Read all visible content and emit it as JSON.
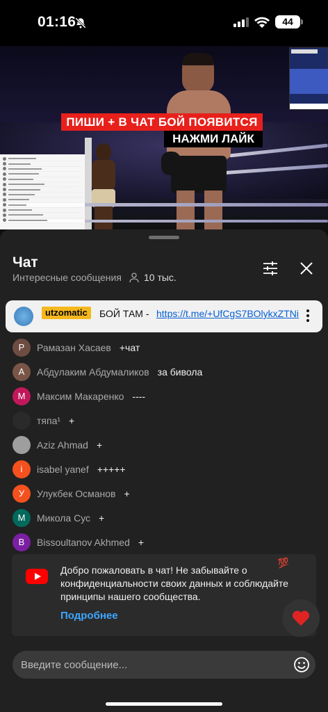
{
  "status_bar": {
    "time": "01:16",
    "battery": "44"
  },
  "video": {
    "promo_line1": "ПИШИ + В ЧАТ БОЙ ПОЯВИТСЯ",
    "promo_line2": "НАЖМИ ЛАЙК"
  },
  "chat": {
    "title": "Чат",
    "subtitle": "Интересные сообщения",
    "viewer_count": "10 тыс.",
    "pinned": {
      "author": "utzomatic",
      "text": "БОЙ ТАМ -",
      "link": "https://t.me/+UfCgS7BOlykxZTNi"
    },
    "messages": [
      {
        "initial": "Р",
        "color": "#6d4c41",
        "author": "Рамазан Хасаев",
        "text": "+чат"
      },
      {
        "initial": "А",
        "color": "#795548",
        "author": "Абдулаким Абдумаликов",
        "text": "за бивола"
      },
      {
        "initial": "М",
        "color": "#c2185b",
        "author": "Максим Макаренко",
        "text": "----"
      },
      {
        "initial": "",
        "color": "#2a2a2a",
        "author": "тяпа¹",
        "text": "+"
      },
      {
        "initial": "",
        "color": "#9e9e9e",
        "author": "Aziz Ahmad",
        "text": "+"
      },
      {
        "initial": "i",
        "color": "#f4511e",
        "author": "isabel yanef",
        "text": "+++++"
      },
      {
        "initial": "У",
        "color": "#f4511e",
        "author": "Улукбек Османов",
        "text": "+"
      },
      {
        "initial": "М",
        "color": "#00695c",
        "author": "Микола Сус",
        "text": "+"
      },
      {
        "initial": "B",
        "color": "#7b1fa2",
        "author": "Bissoultanov Akhmed",
        "text": "+"
      }
    ],
    "welcome": {
      "text": "Добро пожаловать в чат! Не забывайте о конфиденциальности своих данных и соблюдайте принципы нашего сообщества.",
      "learn_more": "Подробнее",
      "sticker": "💯"
    },
    "input_placeholder": "Введите сообщение..."
  }
}
